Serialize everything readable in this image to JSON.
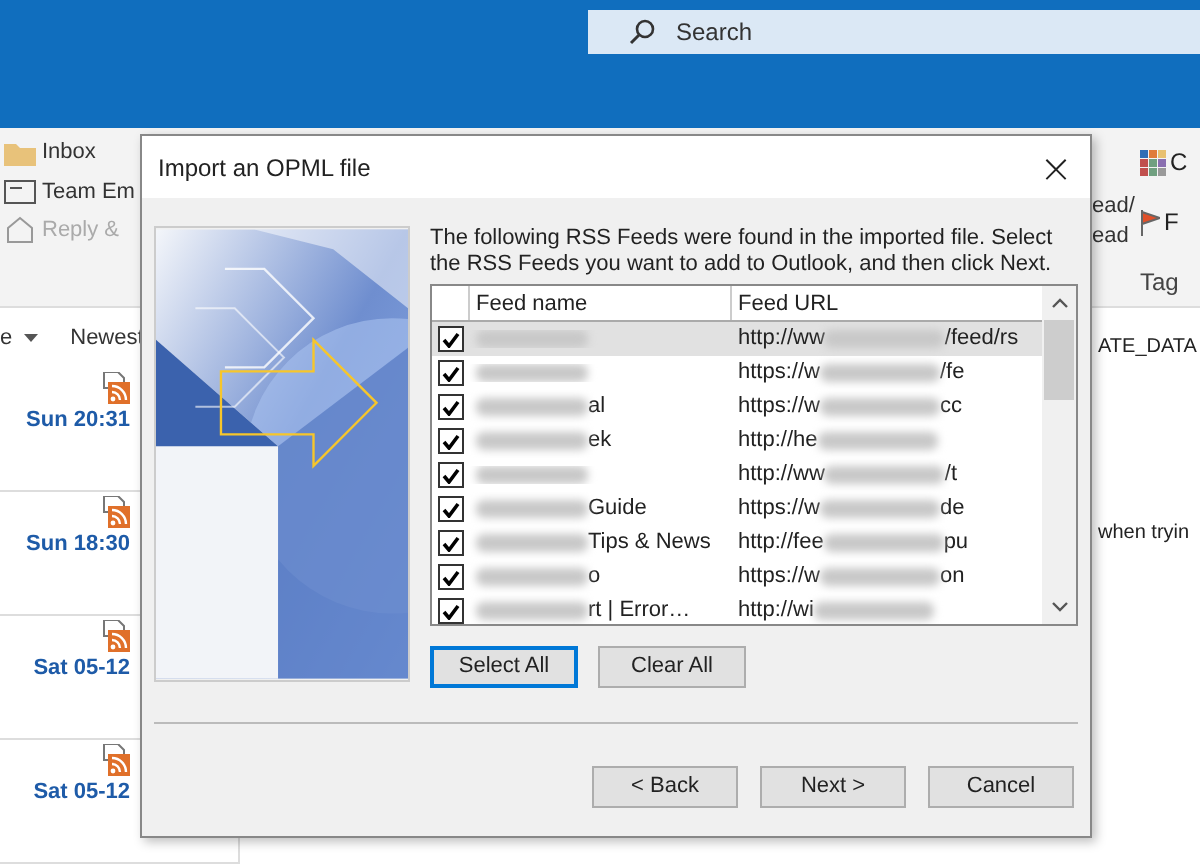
{
  "search": {
    "placeholder": "Search"
  },
  "ribbon": {
    "items": [
      {
        "label": "Inbox",
        "disabled": false
      },
      {
        "label": "Team Em",
        "disabled": false
      },
      {
        "label": "Reply & ",
        "disabled": true
      }
    ],
    "right_texts": [
      "ead/",
      "ead"
    ],
    "flag_label": "F",
    "category_label": "C",
    "group_label": "Tag"
  },
  "message_list": {
    "sort_label": "e",
    "order_label": "Newest",
    "messages": [
      {
        "time": "Sun 20:31"
      },
      {
        "time": "Sun 18:30"
      },
      {
        "time": "Sat 05-12"
      },
      {
        "time": "Sat 05-12"
      }
    ]
  },
  "reading_pane": {
    "lines": [
      "ATE_DATA",
      "when tryin"
    ]
  },
  "dialog": {
    "title": "Import an OPML file",
    "close": "×",
    "instructions": "The following RSS Feeds were found in the imported file. Select the RSS Feeds you want to add to Outlook, and then click Next.",
    "columns": [
      "Feed name",
      "Feed URL"
    ],
    "feeds": [
      {
        "checked": true,
        "selected": true,
        "url_start": "http://ww",
        "url_end": "/feed/rs"
      },
      {
        "checked": true,
        "selected": false,
        "url_start": "https://w",
        "url_end": "/fe"
      },
      {
        "checked": true,
        "selected": false,
        "name": "al",
        "url_start": "https://w",
        "url_end": "cc"
      },
      {
        "checked": true,
        "selected": false,
        "name": "ek",
        "url_start": "http://he"
      },
      {
        "checked": true,
        "selected": false,
        "url_start": "http://ww",
        "url_end": "/t"
      },
      {
        "checked": true,
        "selected": false,
        "name": "Guide",
        "url_start": "https://w",
        "url_end": "de"
      },
      {
        "checked": true,
        "selected": false,
        "name": "Tips & News",
        "url_start": "http://fee",
        "url_end": "pu"
      },
      {
        "checked": true,
        "selected": false,
        "name": "o",
        "url_start": "https://w",
        "url_end": "on"
      },
      {
        "checked": true,
        "selected": false,
        "name": "rt | Error…",
        "url_start": "http://wi"
      }
    ],
    "list_buttons": [
      {
        "label": "Select All",
        "focused": true
      },
      {
        "label": "Clear All",
        "focused": false
      }
    ],
    "buttons": [
      "< Back",
      "Next >",
      "Cancel"
    ]
  }
}
